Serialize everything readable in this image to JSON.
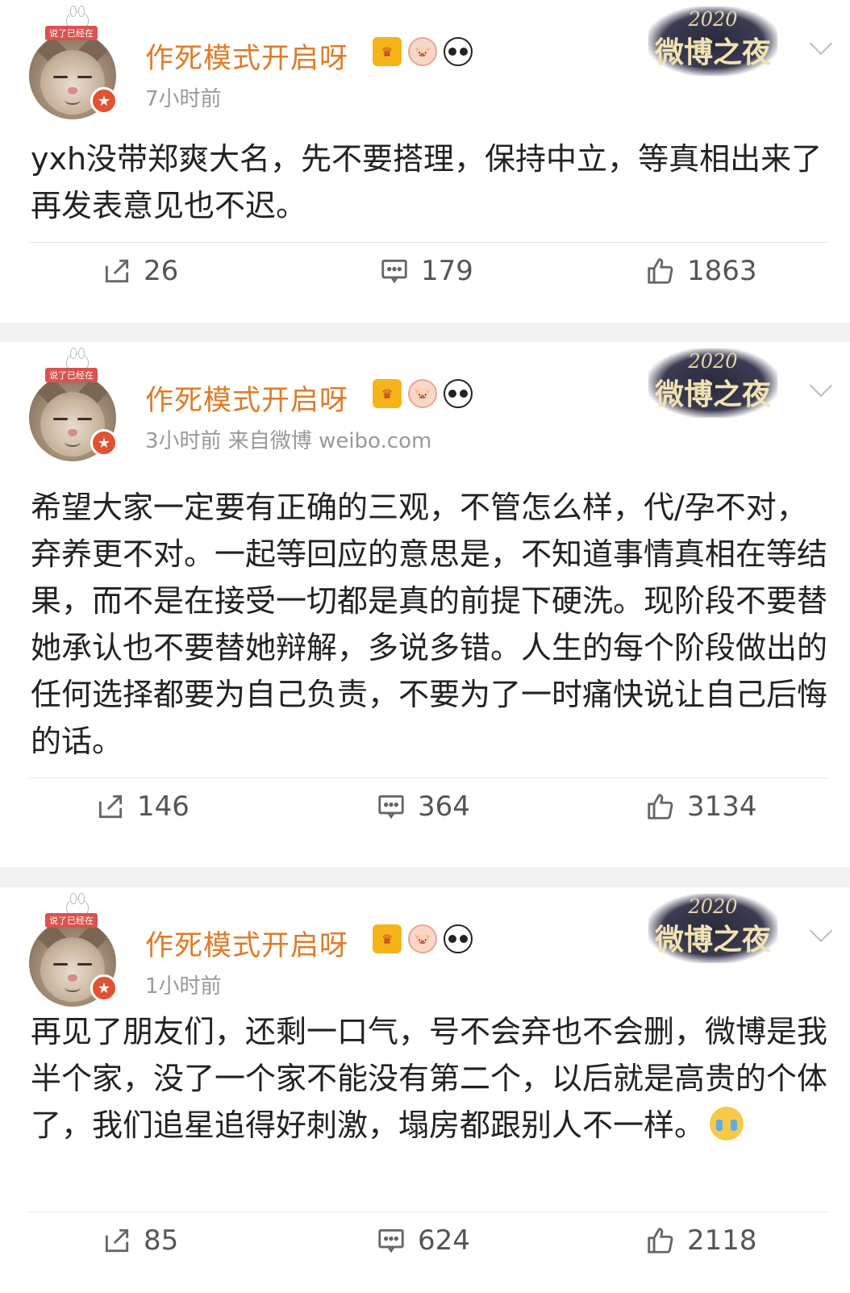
{
  "posts": [
    {
      "username": "作死模式开启呀",
      "avatar_sticker_text": "说了已经在",
      "meta": "7小时前",
      "text": "yxh没带郑爽大名，先不要搭理，保持中立，等真相出来了再发表意见也不迟。",
      "event_logo": {
        "year": "2020",
        "name": "微博之夜"
      },
      "reposts": "26",
      "comments": "179",
      "likes": "1863"
    },
    {
      "username": "作死模式开启呀",
      "avatar_sticker_text": "说了已经在",
      "meta": "3小时前  来自微博 weibo.com",
      "text": "希望大家一定要有正确的三观，不管怎么样，代/孕不对，弃养更不对。一起等回应的意思是，不知道事情真相在等结果，而不是在接受一切都是真的前提下硬洗。现阶段不要替她承认也不要替她辩解，多说多错。人生的每个阶段做出的任何选择都要为自己负责，不要为了一时痛快说让自己后悔的话。",
      "event_logo": {
        "year": "2020",
        "name": "微博之夜"
      },
      "reposts": "146",
      "comments": "364",
      "likes": "3134"
    },
    {
      "username": "作死模式开启呀",
      "avatar_sticker_text": "说了已经在",
      "meta": "1小时前",
      "text": "再见了朋友们，还剩一口气，号不会弃也不会删，微博是我半个家，没了一个家不能没有第二个，以后就是高贵的个体了，我们追星追得好刺激，塌房都跟别人不一样。",
      "event_logo": {
        "year": "2020",
        "name": "微博之夜"
      },
      "reposts": "85",
      "comments": "624",
      "likes": "2118"
    }
  ],
  "icons": {
    "repost": "repost-icon",
    "comment": "comment-icon",
    "like": "thumbs-up-icon",
    "badges": [
      "crown-icon",
      "pig-icon",
      "panda-icon"
    ],
    "post_emoji": "crying-laughing-emoji-icon"
  },
  "colors": {
    "username": "#e07b28",
    "meta": "#999999",
    "verified_badge": "#e05232",
    "background": "#f2f2f2"
  }
}
